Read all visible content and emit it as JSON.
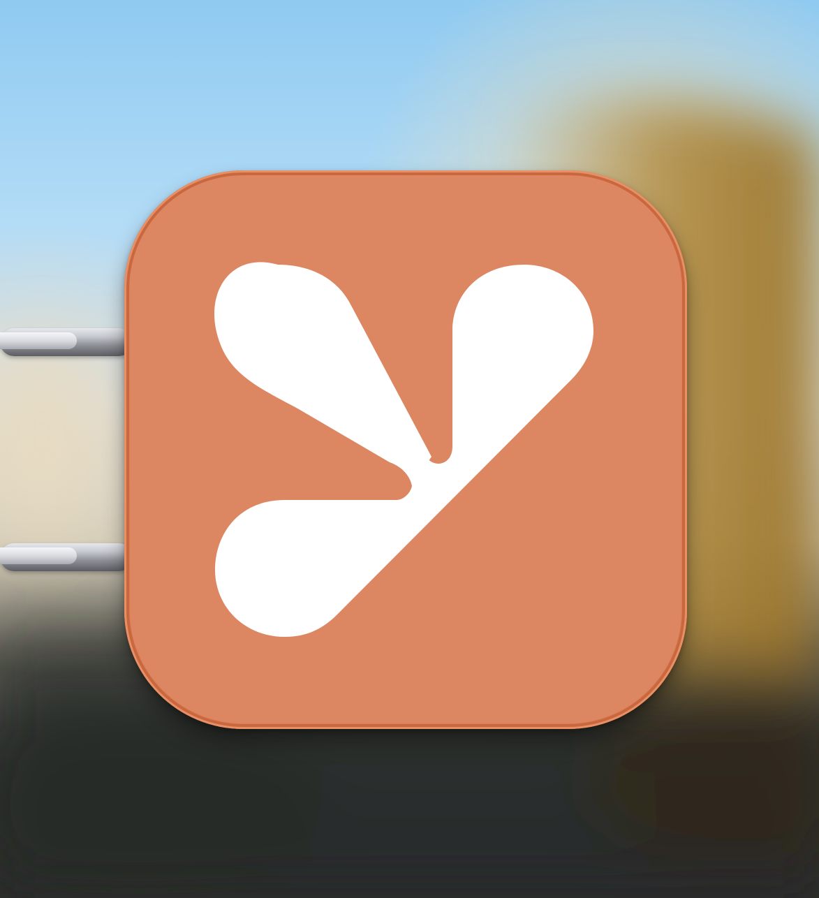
{
  "scene": {
    "description_free": true,
    "sky_color": "#9fd2f2",
    "sign_color": "#dd8762",
    "logo_color": "#ffffff",
    "icon": "three-petal-logo-icon"
  }
}
